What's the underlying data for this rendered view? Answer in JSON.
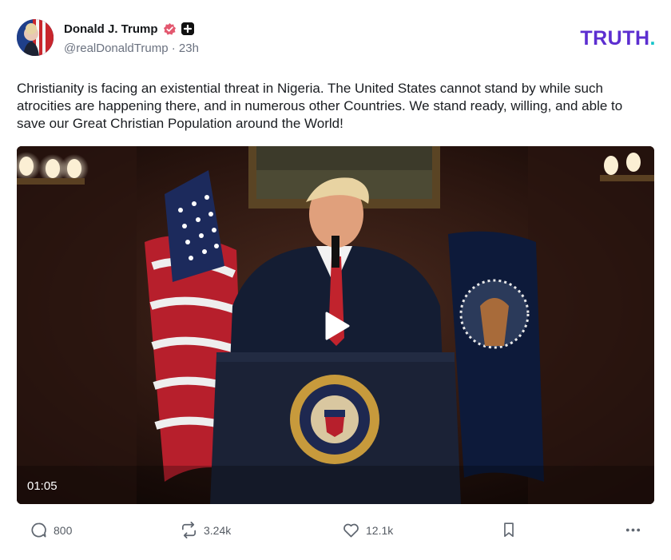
{
  "user": {
    "display_name": "Donald J. Trump",
    "handle": "@realDonaldTrump",
    "separator": "·",
    "timestamp": "23h",
    "badges": [
      "verified-icon",
      "plus-icon"
    ]
  },
  "brand": {
    "name": "TRUTH",
    "dot": ".",
    "color": "#5c2ed0",
    "dot_color": "#13c4c9"
  },
  "post": {
    "text": "Christianity is facing an existential threat in Nigeria. The United States cannot stand by while such atrocities are happening there, and in numerous other Countries. We stand ready, willing, and able to save our Great Christian Population around the World!"
  },
  "video": {
    "duration": "01:05",
    "play_icon": "play-icon"
  },
  "actions": {
    "replies": "800",
    "retruths": "3.24k",
    "likes": "12.1k",
    "icons": [
      "reply-icon",
      "retruth-icon",
      "like-icon",
      "bookmark-icon",
      "more-icon"
    ]
  }
}
